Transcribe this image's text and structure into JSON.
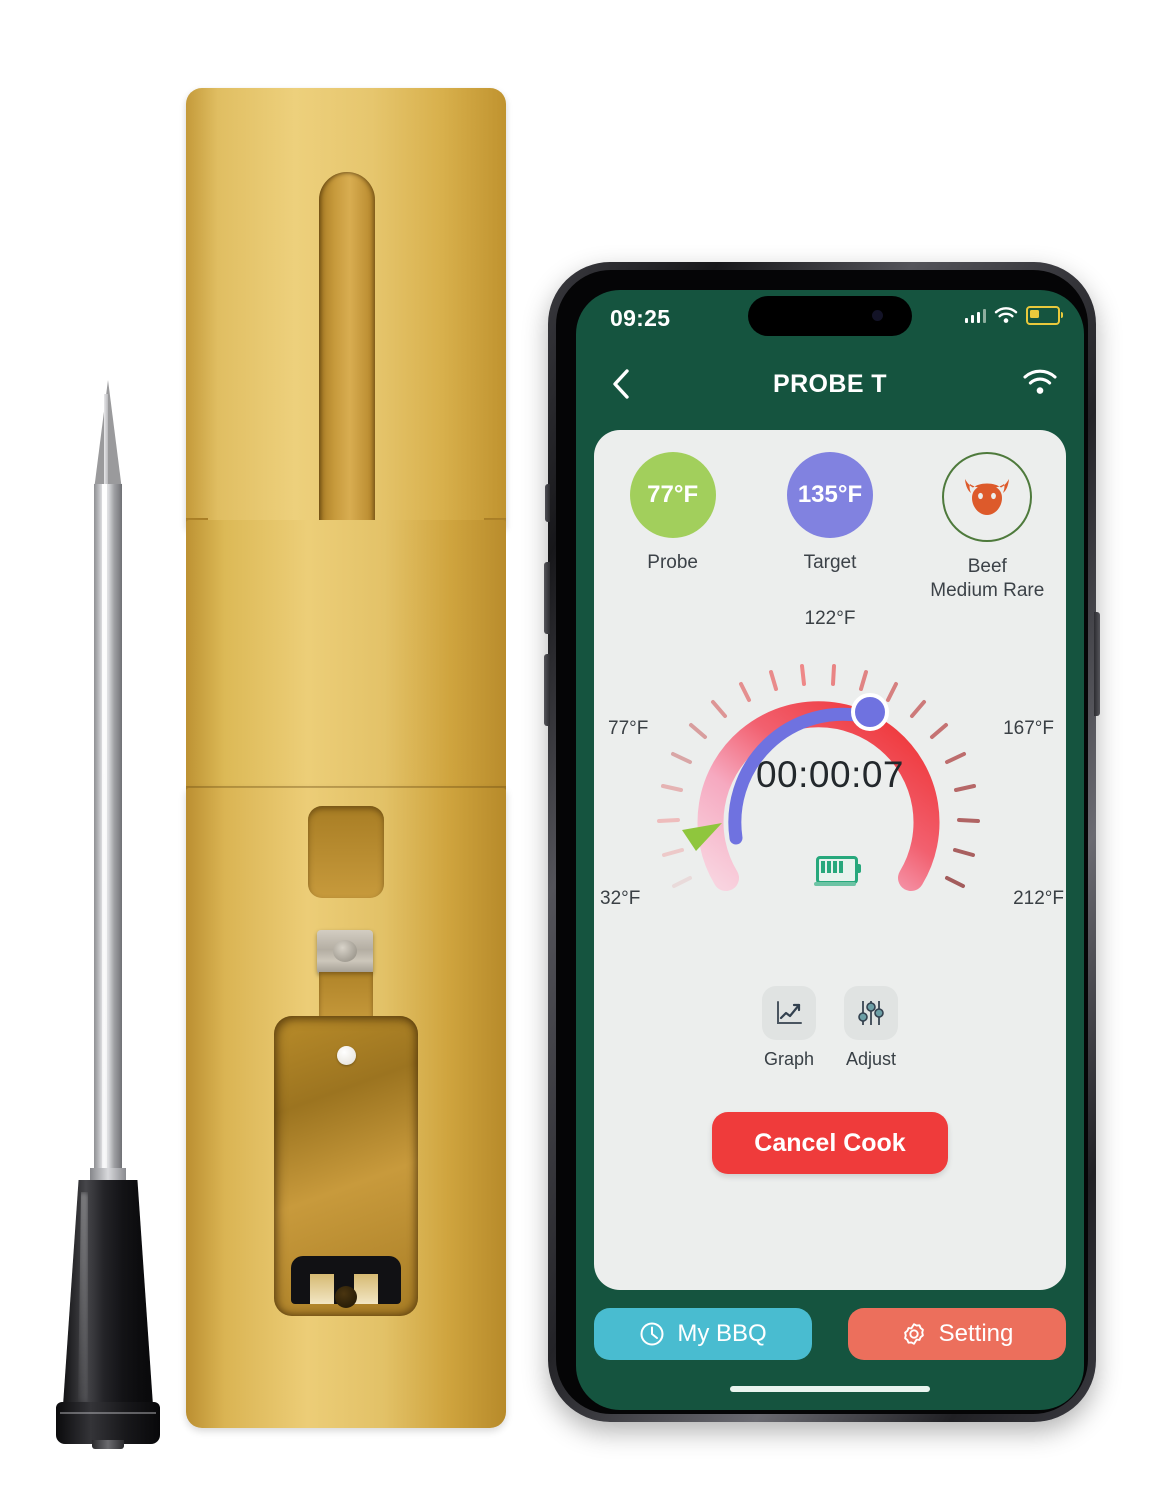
{
  "product": {
    "probe": {
      "name": "wireless-meat-thermometer-probe"
    },
    "case": {
      "name": "bamboo-charging-case"
    }
  },
  "phone": {
    "statusbar": {
      "time": "09:25",
      "signal": "cellular-signal-icon",
      "wifi": "wifi-icon",
      "battery": "battery-low-icon"
    },
    "navbar": {
      "back": "chevron-left-icon",
      "title": "PROBE T",
      "wifi": "wifi-icon"
    },
    "stats": [
      {
        "value": "77°F",
        "label": "Probe",
        "color": "#a2cf5c",
        "icon": null
      },
      {
        "value": "135°F",
        "label": "Target",
        "color": "#8182e0",
        "icon": null
      },
      {
        "value": "",
        "label": "Beef\nMedium Rare",
        "color": "#4e7a3c",
        "icon": "bull-head-icon"
      }
    ],
    "stat_labels": {
      "probe": "Probe",
      "target": "Target",
      "meat_line1": "Beef",
      "meat_line2": "Medium Rare"
    },
    "gauge": {
      "timer": "00:00:07",
      "labels": {
        "top": "122°F",
        "left": "77°F",
        "right": "167°F",
        "bottom_left": "32°F",
        "bottom_right": "212°F"
      },
      "battery_icon": "battery-full-icon",
      "min": 32,
      "max": 212,
      "probe_value": 77,
      "target_value": 135,
      "track_start_color": "#f6c6d6",
      "track_end_color": "#ef3b3b",
      "target_arc_color": "#6f72e0",
      "knob_color": "#6f72e0",
      "marker_color": "#8fc63d"
    },
    "actions": [
      {
        "label": "Graph",
        "icon": "line-chart-icon"
      },
      {
        "label": "Adjust",
        "icon": "sliders-icon"
      }
    ],
    "cancel_label": "Cancel Cook",
    "bottom_bar": [
      {
        "label": "My BBQ",
        "icon": "clock-icon",
        "color": "#49bcd0"
      },
      {
        "label": "Setting",
        "icon": "gear-icon",
        "color": "#ec6f5c"
      }
    ]
  },
  "chart_data": {
    "type": "gauge",
    "title": "Cook Temperature Gauge",
    "min": 32,
    "max": 212,
    "unit": "°F",
    "tick_labels": [
      "32°F",
      "77°F",
      "122°F",
      "167°F",
      "212°F"
    ],
    "tick_values": [
      32,
      77,
      122,
      167,
      212
    ],
    "series": [
      {
        "name": "Probe",
        "value": 77,
        "color": "#8fc63d"
      },
      {
        "name": "Target",
        "value": 135,
        "color": "#6f72e0"
      }
    ],
    "center_text": "00:00:07",
    "grid": false,
    "legend": "none"
  }
}
